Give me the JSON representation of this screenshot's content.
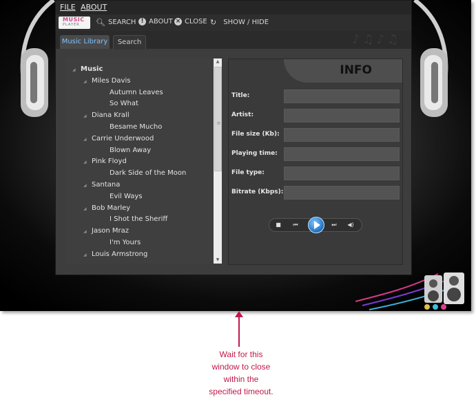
{
  "menu": {
    "file": "FILE",
    "about": "ABOUT"
  },
  "toolbar": {
    "logo_top": "MUSIC",
    "logo_bottom": "PLAYER",
    "search": "SEARCH",
    "about": "ABOUT",
    "close": "CLOSE",
    "show_hide": "SHOW / HIDE",
    "icons": [
      "search-icon",
      "info-icon",
      "close-icon",
      "refresh-icon"
    ]
  },
  "tabs": [
    {
      "label": "Music Library",
      "active": true
    },
    {
      "label": "Search",
      "active": false
    }
  ],
  "tree": {
    "root": "Music",
    "artists": [
      {
        "name": "Miles Davis",
        "songs": [
          "Autumn Leaves",
          "So What"
        ]
      },
      {
        "name": "Diana Krall",
        "songs": [
          "Besame Mucho"
        ]
      },
      {
        "name": "Carrie Underwood",
        "songs": [
          "Blown Away"
        ]
      },
      {
        "name": "Pink Floyd",
        "songs": [
          "Dark Side of the Moon"
        ]
      },
      {
        "name": "Santana",
        "songs": [
          "Evil Ways"
        ]
      },
      {
        "name": "Bob Marley",
        "songs": [
          "I Shot the Sheriff"
        ]
      },
      {
        "name": "Jason Mraz",
        "songs": [
          "I'm Yours"
        ]
      },
      {
        "name": "Louis Armstrong",
        "songs": []
      }
    ]
  },
  "info": {
    "title": "INFO",
    "fields": [
      "Title:",
      "Artist:",
      "File size (Kb):",
      "Playing time:",
      "File type:",
      "Bitrate (Kbps):"
    ]
  },
  "player": {
    "buttons": [
      "stop-icon",
      "previous-icon",
      "play-icon",
      "next-icon",
      "volume-icon"
    ]
  },
  "colors": {
    "accent": "#7fc3ff",
    "annotation": "#c0184a",
    "panel": "#3d3d3d"
  },
  "annotation": {
    "lines": [
      "Wait for this",
      "window to close",
      "within the",
      "specified timeout."
    ]
  }
}
